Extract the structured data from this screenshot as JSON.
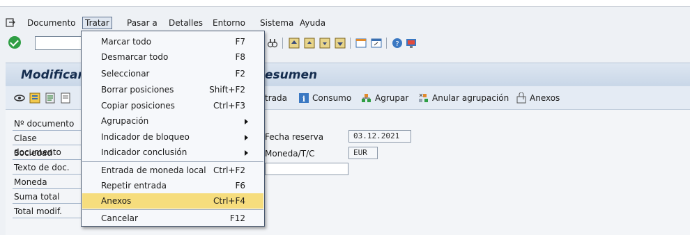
{
  "menubar": {
    "items": [
      "Documento",
      "Tratar",
      "Pasar a",
      "Detalles",
      "Entorno",
      "Sistema",
      "Ayuda"
    ],
    "active": "Tratar"
  },
  "title": {
    "left": "Modificar",
    "right": "esumen"
  },
  "app_toolbar": {
    "entrada_partial": "trada",
    "consumo": "Consumo",
    "agrupar": "Agrupar",
    "anular": "Anular agrupación",
    "anexos": "Anexos"
  },
  "fields": {
    "labels": [
      "Nº documento",
      "Clase documento",
      "Sociedad",
      "Texto de doc.",
      "Moneda",
      "Suma total",
      "Total modif."
    ],
    "fecha_reserva_label": "Fecha reserva",
    "fecha_reserva_value": "03.12.2021",
    "moneda_tc_label": "Moneda/T/C",
    "moneda_tc_value": "EUR"
  },
  "dropdown": {
    "items": [
      {
        "label": "Marcar todo",
        "shortcut": "F7"
      },
      {
        "label": "Desmarcar todo",
        "shortcut": "F8"
      },
      {
        "label": "Seleccionar",
        "shortcut": "F2"
      },
      {
        "label": "Borrar posiciones",
        "shortcut": "Shift+F2"
      },
      {
        "label": "Copiar posiciones",
        "shortcut": "Ctrl+F3"
      },
      {
        "label": "Agrupación",
        "shortcut": ""
      },
      {
        "label": "Indicador de bloqueo",
        "shortcut": ""
      },
      {
        "label": "Indicador conclusión",
        "shortcut": ""
      },
      {
        "label": "Entrada de moneda local",
        "shortcut": "Ctrl+F2"
      },
      {
        "label": "Repetir entrada",
        "shortcut": "F6"
      },
      {
        "label": "Anexos",
        "shortcut": "Ctrl+F4"
      },
      {
        "label": "Cancelar",
        "shortcut": "F12"
      }
    ],
    "highlighted": "Anexos"
  },
  "colors": {
    "highlight": "#f6dd7d",
    "title_text": "#152d4f",
    "ok_green": "#2f9e44"
  },
  "icons": [
    "app-menu-icon",
    "ok-check-icon",
    "info-icon",
    "group-icon",
    "ungroup-icon",
    "attachment-icon"
  ]
}
